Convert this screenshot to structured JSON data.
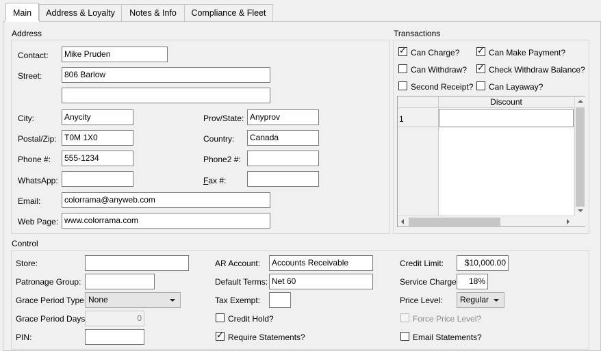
{
  "tabs": [
    {
      "label": "Main"
    },
    {
      "label": "Address & Loyalty"
    },
    {
      "label": "Notes & Info"
    },
    {
      "label": "Compliance & Fleet"
    }
  ],
  "address": {
    "title": "Address",
    "contact_label": "Contact:",
    "contact_value": "Mike Pruden",
    "street_label": "Street:",
    "street_value": "806 Barlow",
    "street2_value": "",
    "city_label": "City:",
    "city_value": "Anycity",
    "prov_label": "Prov/State:",
    "prov_value": "Anyprov",
    "postal_label": "Postal/Zip:",
    "postal_value": "T0M 1X0",
    "country_label": "Country:",
    "country_value": "Canada",
    "phone_label": "Phone #:",
    "phone_value": "555-1234",
    "phone2_label": "Phone2 #:",
    "phone2_value": "",
    "whatsapp_label": "WhatsApp:",
    "whatsapp_value": "",
    "fax_label_first": "F",
    "fax_label_rest": "ax #:",
    "fax_value": "",
    "email_label": "Email:",
    "email_value": "colorrama@anyweb.com",
    "webpage_label": "Web Page:",
    "webpage_value": "www.colorrama.com"
  },
  "transactions": {
    "title": "Transactions",
    "checkboxes": [
      {
        "label": "Can Charge?",
        "checked": true
      },
      {
        "label": "Can Make Payment?",
        "checked": true
      },
      {
        "label": "Can Withdraw?",
        "checked": false
      },
      {
        "label": "Check Withdraw Balance?",
        "checked": true
      },
      {
        "label": "Second Receipt?",
        "checked": false
      },
      {
        "label": "Can Layaway?",
        "checked": false
      }
    ],
    "grid": {
      "column_header": "Discount",
      "rows": [
        {
          "row_number": "1",
          "discount": ""
        }
      ]
    }
  },
  "control": {
    "title": "Control",
    "store_label": "Store:",
    "store_value": "",
    "patronage_label": "Patronage Group:",
    "patronage_value": "",
    "grace_type_label": "Grace Period Type:",
    "grace_type_value": "None",
    "grace_days_label": "Grace Period Days:",
    "grace_days_value": "0",
    "pin_label": "PIN:",
    "pin_value": "",
    "ar_label": "AR Account:",
    "ar_value": "Accounts Receivable",
    "terms_label": "Default Terms:",
    "terms_value": "Net 60",
    "tax_label": "Tax Exempt:",
    "tax_value": "",
    "credit_hold_label": "Credit Hold?",
    "credit_hold_checked": false,
    "require_statements_label": "Require Statements?",
    "require_statements_checked": true,
    "credit_limit_label": "Credit Limit:",
    "credit_limit_value": "$10,000.00",
    "service_charge_label": "Service Charge:",
    "service_charge_value": "18%",
    "price_level_label": "Price Level:",
    "price_level_value": "Regular",
    "force_price_label": "Force Price Level?",
    "force_price_checked": false,
    "email_statements_label": "Email Statements?",
    "email_statements_checked": false
  },
  "colors": {
    "panel_bg": "#f0f0f0",
    "field_bg": "#ffffff",
    "border": "#7a7a7a"
  }
}
